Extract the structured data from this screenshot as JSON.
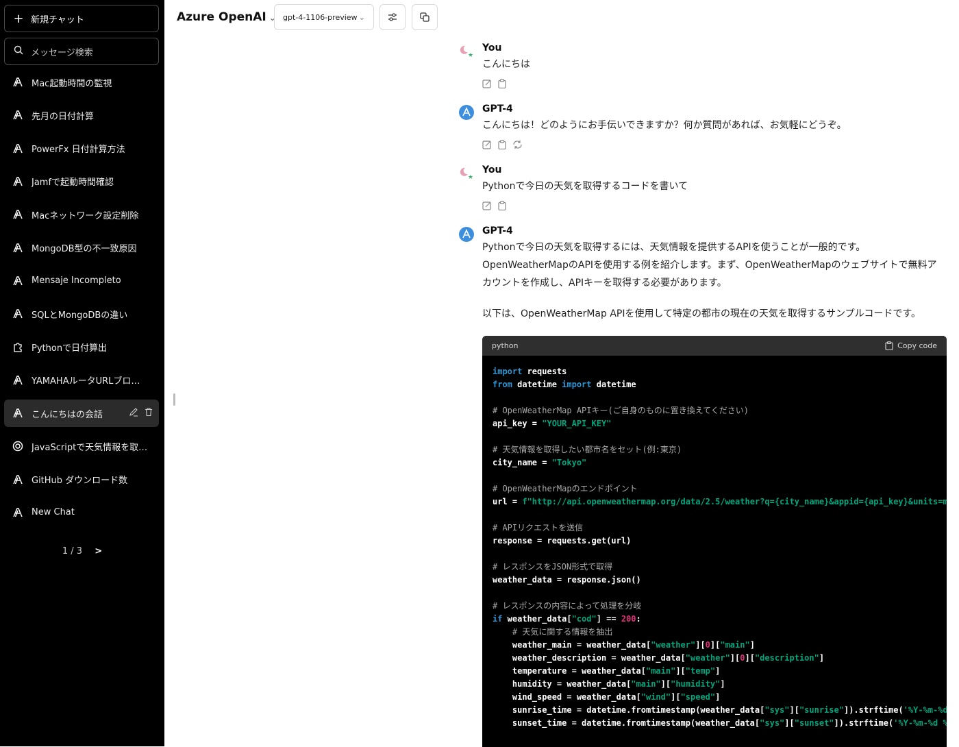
{
  "sidebar": {
    "new_chat": "新規チャット",
    "search_placeholder": "メッセージ検索",
    "items": [
      {
        "label": "Mac起動時間の監視",
        "icon": "azure-openai-icon"
      },
      {
        "label": "先月の日付計算",
        "icon": "azure-openai-icon"
      },
      {
        "label": "PowerFx 日付計算方法",
        "icon": "azure-openai-icon"
      },
      {
        "label": "Jamfで起動時間確認",
        "icon": "azure-openai-icon"
      },
      {
        "label": "Macネットワーク設定削除",
        "icon": "azure-openai-icon"
      },
      {
        "label": "MongoDB型の不一致原因",
        "icon": "azure-openai-icon"
      },
      {
        "label": "Mensaje Incompleto",
        "icon": "azure-openai-icon"
      },
      {
        "label": "SQLとMongoDBの違い",
        "icon": "azure-openai-icon"
      },
      {
        "label": "Pythonで日付算出",
        "icon": "plugin-icon"
      },
      {
        "label": "YAMAHAルータURLブロック",
        "icon": "azure-openai-icon"
      },
      {
        "label": "こんにちはの会話",
        "icon": "azure-openai-icon",
        "active": true
      },
      {
        "label": "JavaScriptで天気情報を取得する方法",
        "icon": "openai-icon"
      },
      {
        "label": "GitHub ダウンロード数",
        "icon": "azure-openai-icon"
      },
      {
        "label": "New Chat",
        "icon": "azure-openai-icon"
      }
    ],
    "pager": {
      "current": "1 / 3",
      "next": ">"
    }
  },
  "header": {
    "endpoint": "Azure OpenAI",
    "model": "gpt-4-1106-preview"
  },
  "messages": [
    {
      "author": "You",
      "text": "こんにちは"
    },
    {
      "author": "GPT-4",
      "text": "こんにちは！どのようにお手伝いできますか？何か質問があれば、お気軽にどうぞ。"
    },
    {
      "author": "You",
      "text": "Pythonで今日の天気を取得するコードを書いて"
    },
    {
      "author": "GPT-4",
      "paragraph1": "Pythonで今日の天気を取得するには、天気情報を提供するAPIを使うことが一般的です。OpenWeatherMapのAPIを使用する例を紹介します。まず、OpenWeatherMapのウェブサイトで無料アカウントを作成し、APIキーを取得する必要があります。",
      "paragraph2": "以下は、OpenWeatherMap APIを使用して特定の都市の現在の天気を取得するサンプルコードです。"
    }
  ],
  "code_block": {
    "language": "python",
    "copy_label": "Copy code",
    "lines": [
      "import requests",
      "from datetime import datetime",
      "",
      "# OpenWeatherMap APIキー(ご自身のものに置き換えてください)",
      "api_key = \"YOUR_API_KEY\"",
      "",
      "# 天気情報を取得したい都市名をセット(例:東京)",
      "city_name = \"Tokyo\"",
      "",
      "# OpenWeatherMapのエンドポイント",
      "url = f\"http://api.openweathermap.org/data/2.5/weather?q={city_name}&appid={api_key}&units=metric\"",
      "",
      "# APIリクエストを送信",
      "response = requests.get(url)",
      "",
      "# レスポンスをJSON形式で取得",
      "weather_data = response.json()",
      "",
      "# レスポンスの内容によって処理を分岐",
      "if weather_data[\"cod\"] == 200:",
      "    # 天気に関する情報を抽出",
      "    weather_main = weather_data[\"weather\"][0][\"main\"]",
      "    weather_description = weather_data[\"weather\"][0][\"description\"]",
      "    temperature = weather_data[\"main\"][\"temp\"]",
      "    humidity = weather_data[\"main\"][\"humidity\"]",
      "    wind_speed = weather_data[\"wind\"][\"speed\"]",
      "    sunrise_time = datetime.fromtimestamp(weather_data[\"sys\"][\"sunrise\"]).strftime('%Y-%m-%d %H:%M:%S')",
      "    sunset_time = datetime.fromtimestamp(weather_data[\"sys\"][\"sunset\"]).strftime('%Y-%m-%d %H:%M:%S')"
    ]
  },
  "colors": {
    "sidebar_bg": "#000000",
    "active_item_bg": "#2b2b2b",
    "code_keyword": "#2e95d3",
    "code_string": "#00a67d",
    "code_number": "#df3079",
    "gpt_avatar": "#3e8ede"
  }
}
